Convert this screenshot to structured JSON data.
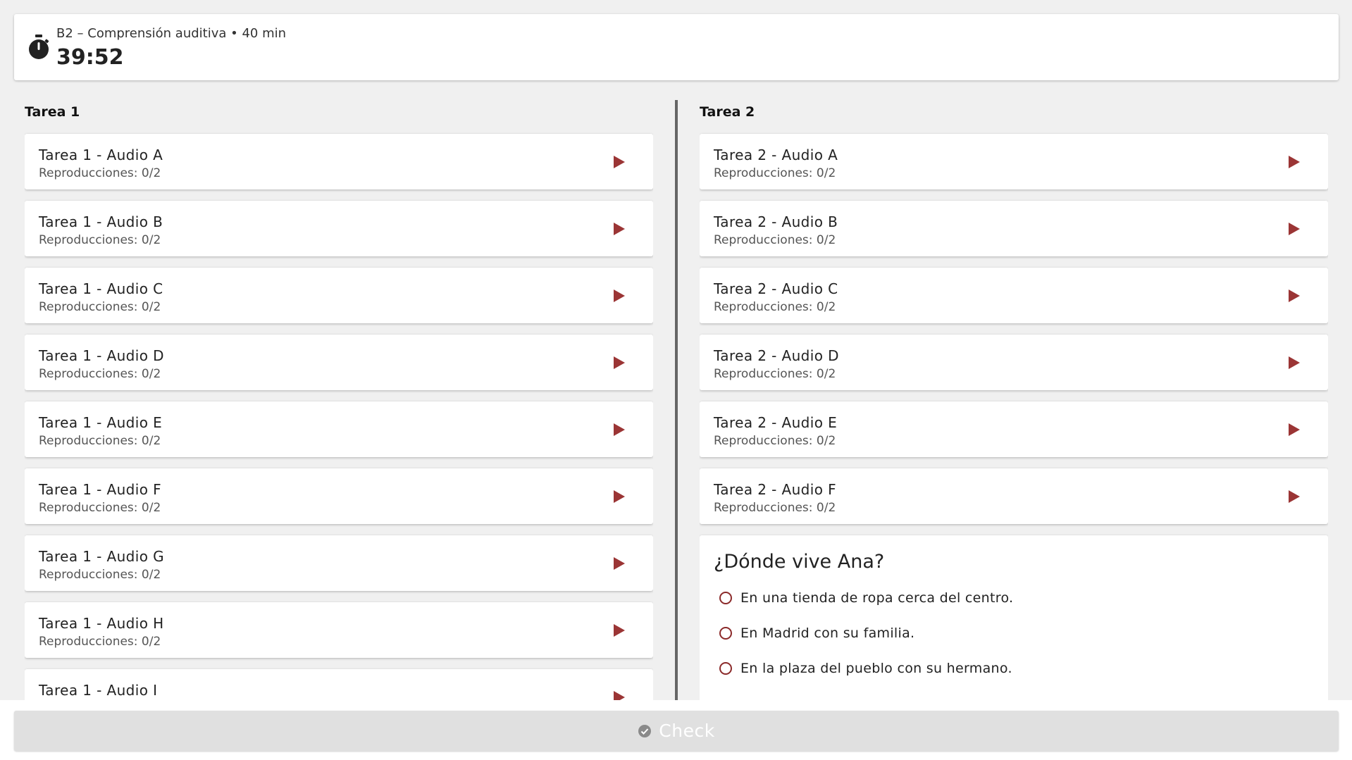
{
  "header": {
    "exam_label": "B2 – Comprensión auditiva • 40 min",
    "timer": "39:52"
  },
  "left": {
    "title": "Tarea 1",
    "items": [
      {
        "title": "Tarea 1 - Audio A",
        "plays": "Reproducciones: 0/2"
      },
      {
        "title": "Tarea 1 - Audio B",
        "plays": "Reproducciones: 0/2"
      },
      {
        "title": "Tarea 1 - Audio C",
        "plays": "Reproducciones: 0/2"
      },
      {
        "title": "Tarea 1 - Audio D",
        "plays": "Reproducciones: 0/2"
      },
      {
        "title": "Tarea 1 - Audio E",
        "plays": "Reproducciones: 0/2"
      },
      {
        "title": "Tarea 1 - Audio F",
        "plays": "Reproducciones: 0/2"
      },
      {
        "title": "Tarea 1 - Audio G",
        "plays": "Reproducciones: 0/2"
      },
      {
        "title": "Tarea 1 - Audio H",
        "plays": "Reproducciones: 0/2"
      },
      {
        "title": "Tarea 1 - Audio I",
        "plays": ""
      }
    ]
  },
  "right": {
    "title": "Tarea 2",
    "items": [
      {
        "title": "Tarea 2 - Audio A",
        "plays": "Reproducciones: 0/2"
      },
      {
        "title": "Tarea 2 - Audio B",
        "plays": "Reproducciones: 0/2"
      },
      {
        "title": "Tarea 2 - Audio C",
        "plays": "Reproducciones: 0/2"
      },
      {
        "title": "Tarea 2 - Audio D",
        "plays": "Reproducciones: 0/2"
      },
      {
        "title": "Tarea 2 - Audio E",
        "plays": "Reproducciones: 0/2"
      },
      {
        "title": "Tarea 2 - Audio F",
        "plays": "Reproducciones: 0/2"
      }
    ],
    "question": {
      "text": "¿Dónde vive Ana?",
      "options": [
        "En una tienda de ropa cerca del centro.",
        "En Madrid con su familia.",
        "En la plaza del pueblo con su hermano."
      ]
    }
  },
  "footer": {
    "check_label": "Check"
  },
  "colors": {
    "accent": "#9b3535",
    "background": "#f0f0f0",
    "disabled_button": "#e0e0e0"
  },
  "icons": {
    "timer": "stopwatch-icon",
    "play": "play-icon",
    "check": "check-circle-icon"
  }
}
